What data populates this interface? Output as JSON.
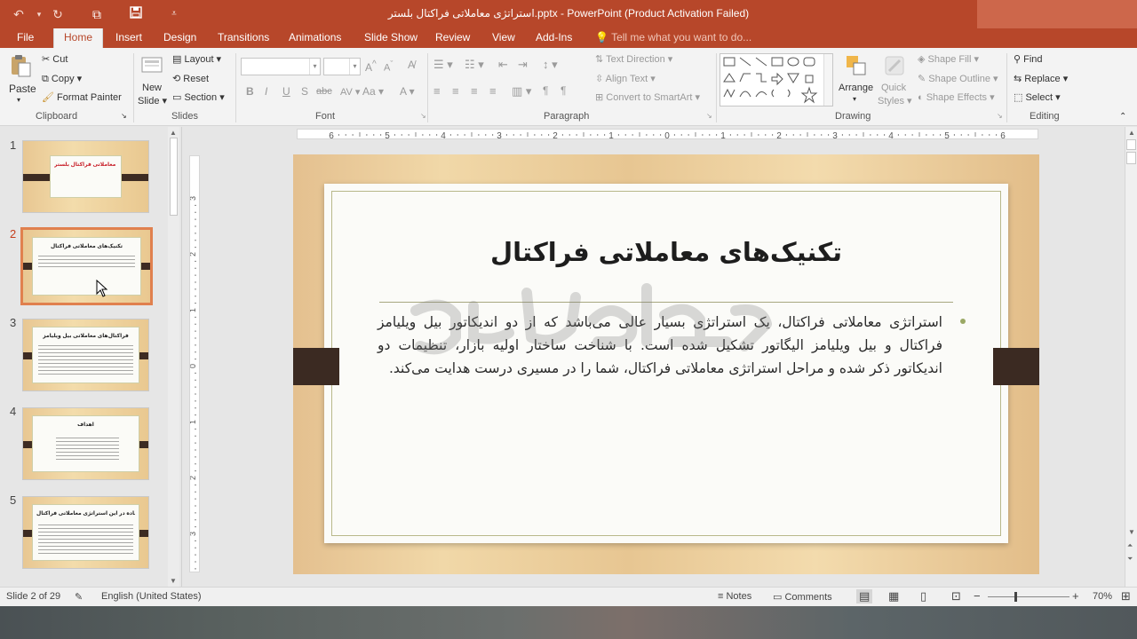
{
  "titlebar": {
    "title": "استراتژی معاملاتی فراکتال بلستر.pptx - PowerPoint (Product Activation Failed)"
  },
  "tabs": [
    "File",
    "Home",
    "Insert",
    "Design",
    "Transitions",
    "Animations",
    "Slide Show",
    "Review",
    "View",
    "Add-Ins"
  ],
  "tell_me": "Tell me what you want to do...",
  "clipboard": {
    "paste": "Paste",
    "cut": "Cut",
    "copy": "Copy",
    "format_painter": "Format Painter",
    "label": "Clipboard"
  },
  "slides_group": {
    "new_slide_line1": "New",
    "new_slide_line2": "Slide",
    "layout": "Layout",
    "reset": "Reset",
    "section": "Section",
    "label": "Slides"
  },
  "font_group": {
    "label": "Font"
  },
  "paragraph_group": {
    "text_direction": "Text Direction",
    "align_text": "Align Text",
    "convert_smartart": "Convert to SmartArt",
    "label": "Paragraph"
  },
  "drawing_group": {
    "arrange": "Arrange",
    "quick_line1": "Quick",
    "quick_line2": "Styles",
    "shape_fill": "Shape Fill",
    "shape_outline": "Shape Outline",
    "shape_effects": "Shape Effects",
    "label": "Drawing"
  },
  "editing_group": {
    "find": "Find",
    "replace": "Replace",
    "select": "Select",
    "label": "Editing"
  },
  "thumbnails": [
    {
      "num": "1",
      "title": "استراتژی معاملاتی فراکتال بلستر"
    },
    {
      "num": "2",
      "title": "تکنیک‌های معاملاتی فراکتال"
    },
    {
      "num": "3",
      "title": "فراکتال‌های معاملاتی بیل ویلیامز"
    },
    {
      "num": "4",
      "title": "اهداف"
    },
    {
      "num": "5",
      "title": "اندیکاتورهای مورد استفاده در این استراتژی معاملاتی فراکتال"
    }
  ],
  "slide": {
    "title": "تکنیک‌های معاملاتی فراکتال",
    "body": "استراتژی معاملاتی فراکتال، یک استراتژی بسیار عالی می‌باشد که از دو اندیکاتور بیل ویلیامز فراکتال و بیل ویلیامز الیگاتور تشکیل شده است. با شناخت ساختار اولیه بازار، تنظیمات دو اندیکاتور ذکر شده و مراحل استراتژی معاملاتی فراکتال، شما را در مسیری درست هدایت می‌کند."
  },
  "ruler_h": [
    "6",
    "5",
    "4",
    "3",
    "2",
    "1",
    "0",
    "1",
    "2",
    "3",
    "4",
    "5",
    "6"
  ],
  "ruler_v": [
    "3",
    "2",
    "1",
    "0",
    "1",
    "2",
    "3"
  ],
  "status": {
    "slide_info": "Slide 2 of 29",
    "language": "English (United States)",
    "notes": "Notes",
    "comments": "Comments",
    "zoom": "70%"
  }
}
